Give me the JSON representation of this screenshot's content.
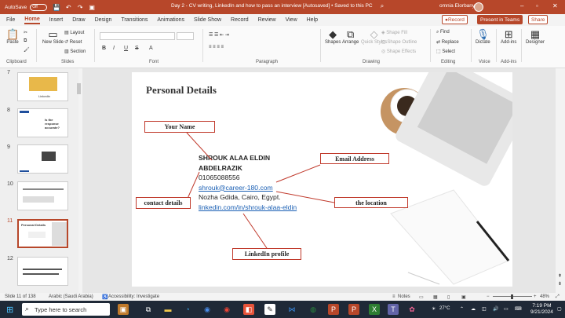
{
  "titlebar": {
    "autosave_label": "AutoSave",
    "autosave_state": "Off",
    "document_title": "Day 2 - CV writing, LinkedIn and how to pass an interview [Autosaved] • Saved to this PC",
    "user_name": "omnia Elorbany"
  },
  "menu": {
    "tabs": [
      "File",
      "Home",
      "Insert",
      "Draw",
      "Design",
      "Transitions",
      "Animations",
      "Slide Show",
      "Record",
      "Review",
      "View",
      "Help"
    ],
    "record_label": "Record",
    "teams_label": "Present in Teams",
    "share_label": "Share"
  },
  "ribbon": {
    "paste": "Paste",
    "new_slide": "New Slide",
    "layout": "Layout",
    "reset": "Reset",
    "section": "Section",
    "shapes": "Shapes",
    "arrange": "Arrange",
    "quick_styles": "Quick Styles",
    "shape_fill": "Shape Fill",
    "shape_outline": "Shape Outline",
    "shape_effects": "Shape Effects",
    "find": "Find",
    "replace": "Replace",
    "select": "Select",
    "dictate": "Dictate",
    "addins": "Add-ins",
    "designer": "Designer",
    "groups": {
      "clipboard": "Clipboard",
      "slides": "Slides",
      "font": "Font",
      "paragraph": "Paragraph",
      "drawing": "Drawing",
      "editing": "Editing",
      "voice": "Voice",
      "addins": "Add-ins"
    },
    "bold": "B",
    "italic": "I",
    "underline": "U",
    "strike": "S"
  },
  "thumbnails": [
    {
      "num": "7",
      "caption": "Linkedin"
    },
    {
      "num": "8",
      "caption": "Is the response accurate?"
    },
    {
      "num": "9",
      "caption": ""
    },
    {
      "num": "10",
      "caption": ""
    },
    {
      "num": "11",
      "caption": "Personal Details"
    },
    {
      "num": "12",
      "caption": ""
    }
  ],
  "slide": {
    "title": "Personal Details",
    "name": "SHROUK ALAA ELDIN ABDELRAZIK",
    "phone": "01065088556",
    "email": "shrouk@career-180.com",
    "address": "Nozha Gdida, Cairo, Egypt.",
    "linkedin": "linkedin.com/in/shrouk-alaa-eldin",
    "labels": {
      "your_name": "Your Name",
      "email_address": "Email Address",
      "contact_details": "contact details",
      "the_location": "the location",
      "linkedin_profile": "LinkedIn profile"
    }
  },
  "status": {
    "slide_info": "Slide 11 of 138",
    "language": "Arabic (Saudi Arabia)",
    "accessibility": "Accessibility: Investigate",
    "notes": "Notes",
    "zoom": "48%"
  },
  "taskbar": {
    "search_placeholder": "Type here to search",
    "temperature": "27°C",
    "time": "7:19 PM",
    "date": "9/21/2024"
  },
  "colors": {
    "accent": "#b7472a",
    "label_border": "#c0392b",
    "link": "#1a5fb4"
  }
}
